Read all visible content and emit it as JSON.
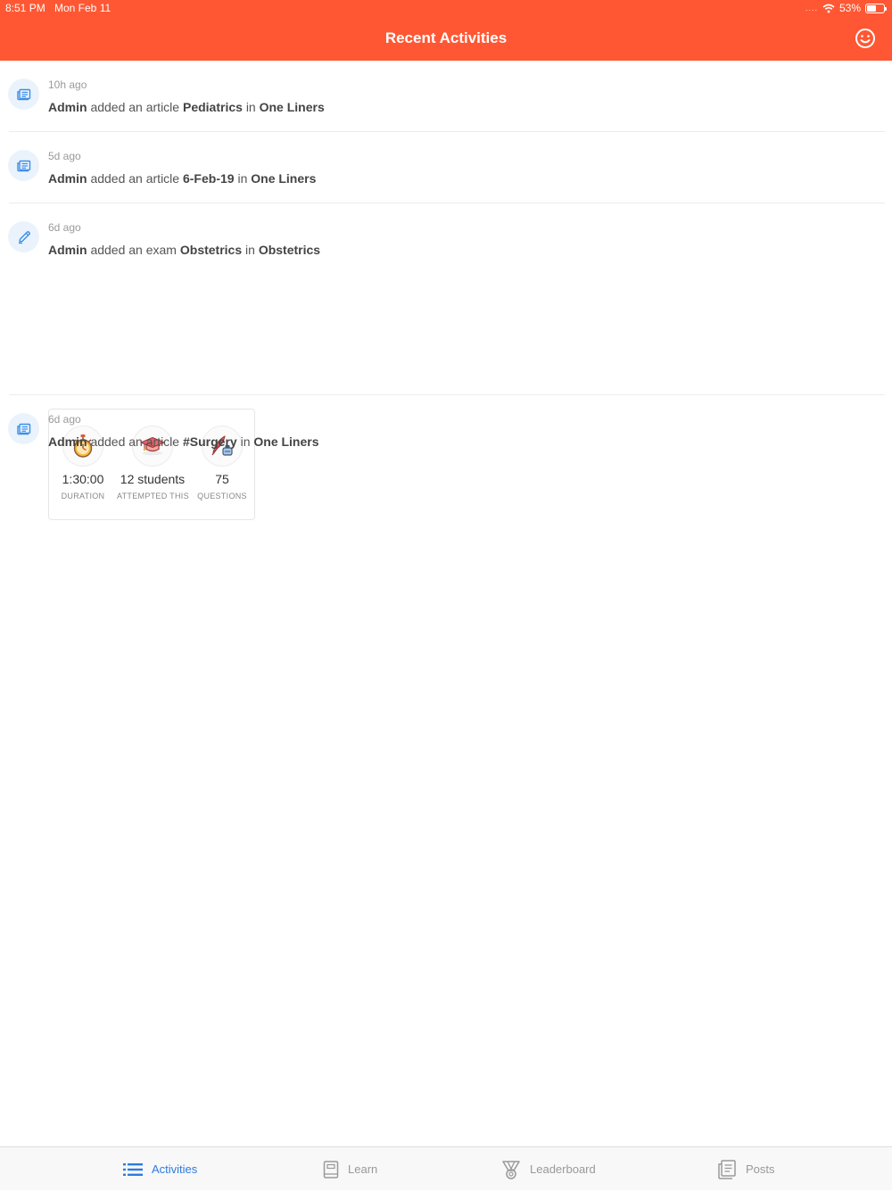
{
  "status_bar": {
    "time": "8:51 PM",
    "date": "Mon Feb 11",
    "signal": "....",
    "battery": "53%",
    "battery_level": 0.53
  },
  "header": {
    "title": "Recent Activities",
    "action_icon": "smiley-icon"
  },
  "activities": [
    {
      "time": "10h ago",
      "actor": "Admin",
      "verb": "added an article",
      "object": "Pediatrics",
      "prep": "in",
      "target": "One Liners",
      "icon": "article-icon"
    },
    {
      "time": "5d ago",
      "actor": "Admin",
      "verb": "added an article",
      "object": "6-Feb-19",
      "prep": "in",
      "target": "One Liners",
      "icon": "article-icon"
    },
    {
      "time": "6d ago",
      "actor": "Admin",
      "verb": "added an exam",
      "object": "Obstetrics",
      "prep": "in",
      "target": "Obstetrics",
      "icon": "pencil-icon",
      "exam": {
        "duration_value": "1:30:00",
        "duration_label": "DURATION",
        "students_value": "12 students",
        "students_label": "ATTEMPTED THIS",
        "questions_value": "75",
        "questions_label": "QUESTIONS"
      }
    },
    {
      "time": "6d ago",
      "actor": "Admin",
      "verb": "added an article",
      "object": "#Surgery",
      "prep": "in",
      "target": "One Liners",
      "icon": "article-icon"
    }
  ],
  "tabs": [
    {
      "label": "Activities",
      "icon": "list-icon",
      "active": true
    },
    {
      "label": "Learn",
      "icon": "book-icon",
      "active": false
    },
    {
      "label": "Leaderboard",
      "icon": "medal-icon",
      "active": false
    },
    {
      "label": "Posts",
      "icon": "document-icon",
      "active": false
    }
  ],
  "colors": {
    "header": "#ff5733",
    "accent": "#2d7be0",
    "icon_bg": "#eaf3fc"
  }
}
